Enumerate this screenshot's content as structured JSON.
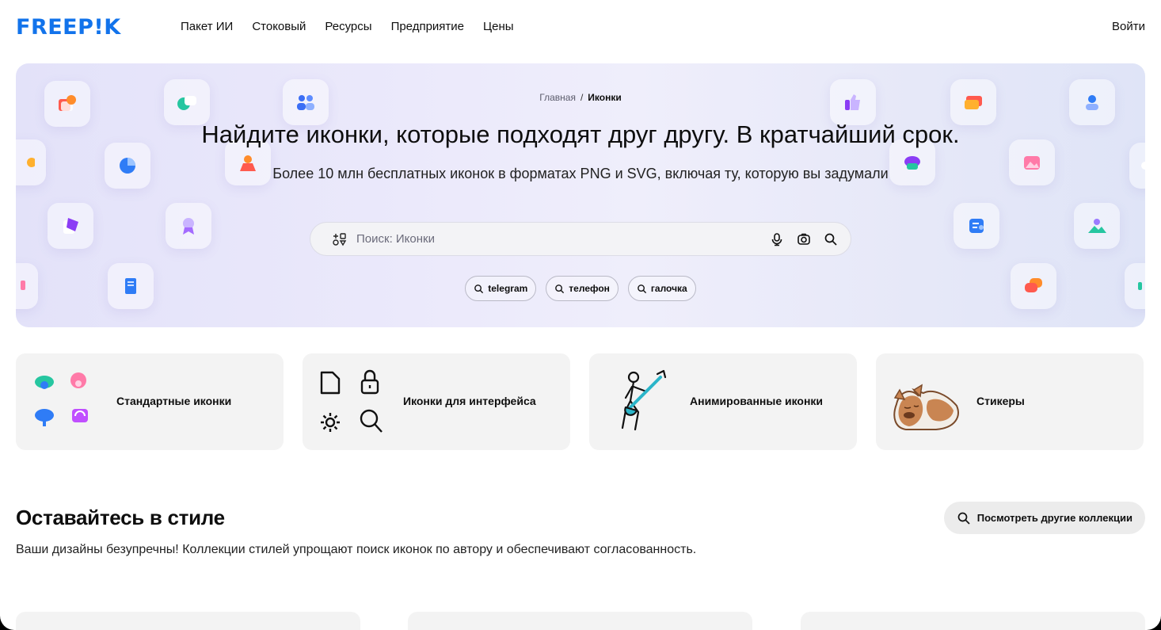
{
  "header": {
    "logo": "FREEP!K",
    "nav": [
      "Пакет ИИ",
      "Стоковый",
      "Ресурсы",
      "Предприятие",
      "Цены"
    ],
    "login": "Войти"
  },
  "hero": {
    "breadcrumb": {
      "home": "Главная",
      "separator": "/",
      "current": "Иконки"
    },
    "title": "Найдите иконки, которые подходят друг другу. В кратчайший срок.",
    "subtitle": "Более 10 млн бесплатных иконок в форматах PNG и SVG, включая ту, которую вы задумали",
    "search": {
      "placeholder": "Поиск: Иконки",
      "value": ""
    },
    "chips": [
      "telegram",
      "телефон",
      "галочка"
    ]
  },
  "categories": [
    {
      "label": "Стандартные иконки",
      "icon": "colorful-icons-grid"
    },
    {
      "label": "Иконки для интерфейса",
      "icon": "interface-icons-grid"
    },
    {
      "label": "Анимированные иконки",
      "icon": "animated-guitar-figure"
    },
    {
      "label": "Стикеры",
      "icon": "sleeping-dog-sticker"
    }
  ],
  "section": {
    "title": "Оставайтесь в стиле",
    "description": "Ваши дизайны безупречны! Коллекции стилей упрощают поиск иконок по автору и обеспечивают согласованность.",
    "more_button": "Посмотреть другие коллекции"
  },
  "colors": {
    "brand": "#1273eb",
    "hero_bg": "#ebe9fb",
    "card_bg": "#f3f3f3"
  }
}
